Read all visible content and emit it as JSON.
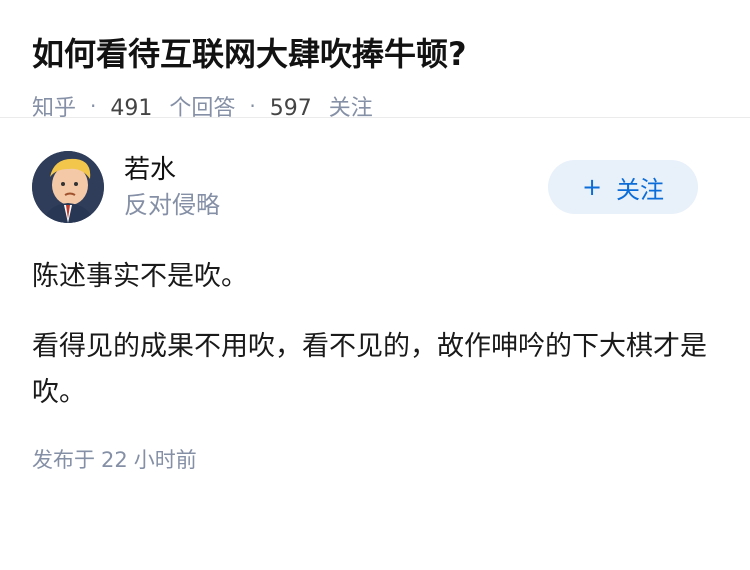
{
  "question": {
    "title": "如何看待互联网大肆吹捧牛顿?",
    "source": "知乎",
    "answers_count": "491",
    "answers_label": "个回答",
    "follow_count": "597",
    "follow_label": "关注"
  },
  "answer": {
    "author_name": "若水",
    "author_bio": "反对侵略",
    "follow_button": "关注",
    "follow_plus": "+",
    "paragraphs": [
      "陈述事实不是吹。",
      "看得见的成果不用吹，看不见的，故作呻吟的下大棋才是吹。"
    ],
    "published_prefix": "发布于",
    "published_num": "22",
    "published_suffix": "小时前"
  },
  "colors": {
    "accent": "#0c6dd8",
    "muted": "#8590a6",
    "button_bg": "#e8f0fa"
  }
}
